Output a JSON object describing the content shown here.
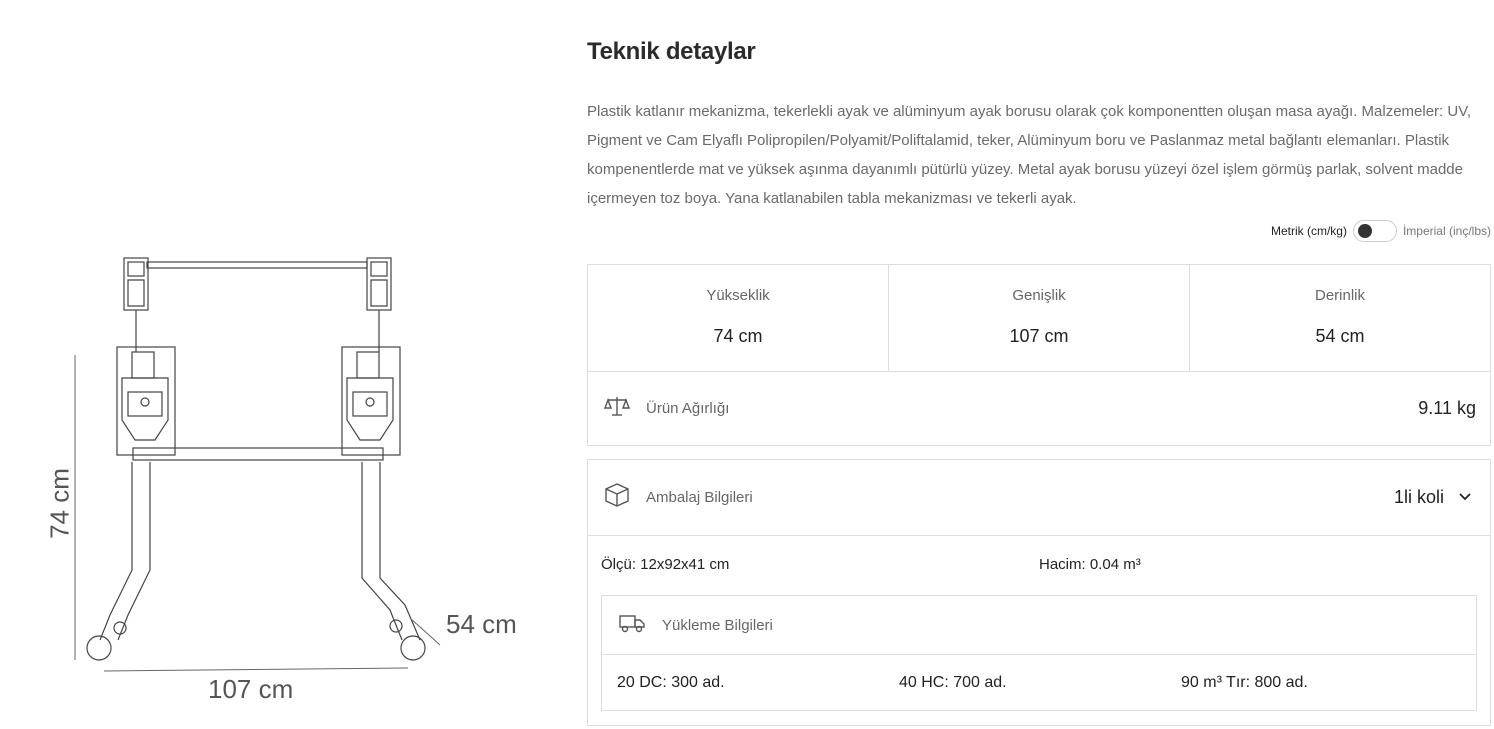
{
  "drawing": {
    "height_label": "74 cm",
    "width_label": "107 cm",
    "depth_label": "54 cm"
  },
  "details": {
    "title": "Teknik detaylar",
    "description": "Plastik katlanır mekanizma, tekerlekli ayak ve alüminyum ayak borusu olarak çok komponentten oluşan masa ayağı. Malzemeler: UV, Pigment ve Cam Elyaflı Polipropilen/Polyamit/Poliftalamid, teker, Alüminyum boru ve Paslanmaz metal bağlantı elemanları. Plastik kompenentlerde mat ve yüksek aşınma dayanımlı pütürlü yüzey. Metal ayak borusu yüzeyi özel işlem görmüş parlak, solvent madde içermeyen toz boya. Yana katlanabilen tabla mekanizması ve tekerli ayak."
  },
  "unit_toggle": {
    "metric_label": "Metrik (cm/kg)",
    "imperial_label": "İmperial (inç/lbs)",
    "selected": "metric"
  },
  "dimensions": {
    "height": {
      "label": "Yükseklik",
      "value": "74 cm"
    },
    "width": {
      "label": "Genişlik",
      "value": "107 cm"
    },
    "depth": {
      "label": "Derinlik",
      "value": "54 cm"
    }
  },
  "weight": {
    "icon": "scale-icon",
    "label": "Ürün Ağırlığı",
    "value": "9.11 kg"
  },
  "packaging": {
    "icon": "box-icon",
    "label": "Ambalaj Bilgileri",
    "selected_option": "1li koli",
    "size": "Ölçü: 12x92x41 cm",
    "volume": "Hacim: 0.04 m³",
    "loading": {
      "icon": "truck-icon",
      "label": "Yükleme Bilgileri",
      "dc20": "20 DC: 300 ad.",
      "hc40": "40 HC: 700 ad.",
      "truck90": "90 m³ Tır: 800 ad."
    }
  }
}
